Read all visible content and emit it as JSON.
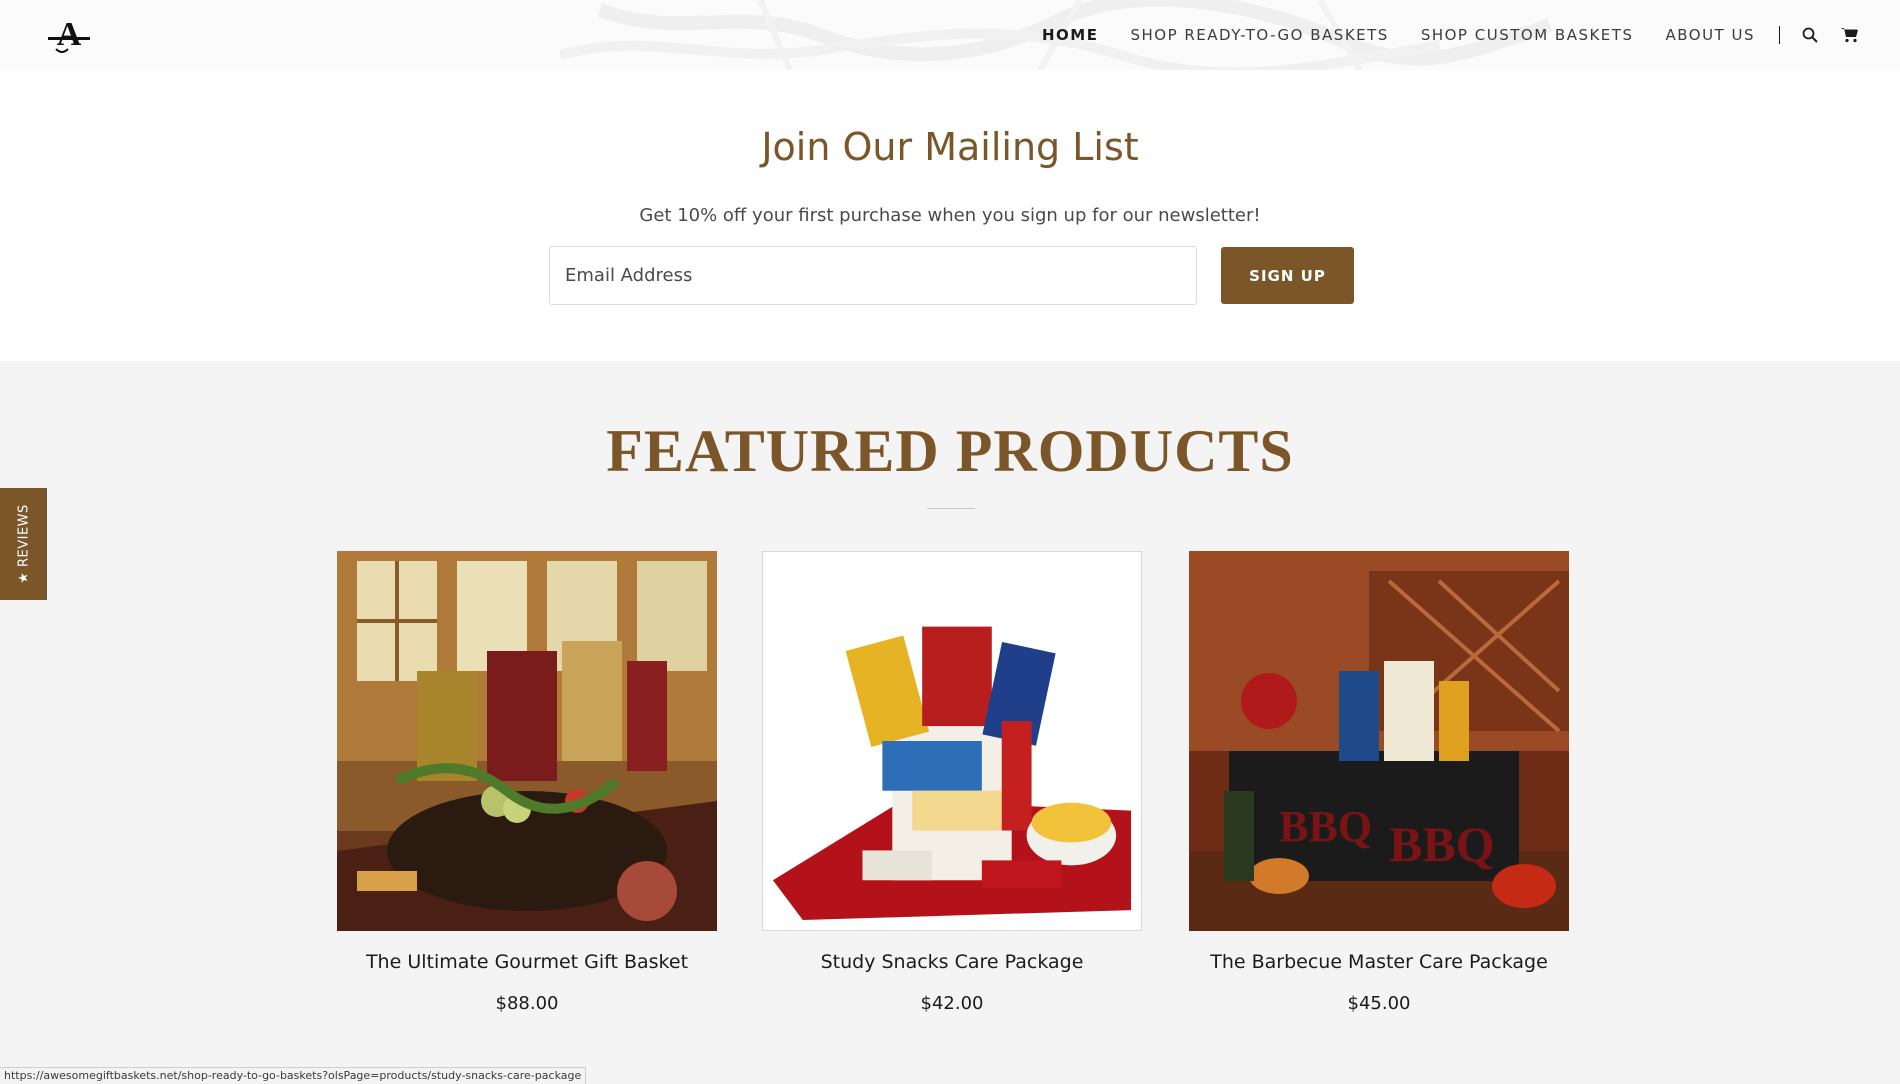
{
  "header": {
    "nav": [
      {
        "label": "HOME",
        "active": true
      },
      {
        "label": "SHOP READY-TO-GO BASKETS",
        "active": false
      },
      {
        "label": "SHOP CUSTOM BASKETS",
        "active": false
      },
      {
        "label": "ABOUT US",
        "active": false
      }
    ],
    "icons": {
      "search": "search-icon",
      "cart": "cart-icon"
    }
  },
  "mailing": {
    "title": "Join Our Mailing List",
    "subtitle": "Get 10% off your first purchase when you sign up for our newsletter!",
    "email_placeholder": "Email Address",
    "signup_label": "SIGN UP"
  },
  "featured": {
    "title": "FEATURED PRODUCTS",
    "products": [
      {
        "name": "The Ultimate Gourmet Gift Basket",
        "price": "$88.00"
      },
      {
        "name": "Study Snacks Care Package",
        "price": "$42.00"
      },
      {
        "name": "The Barbecue Master Care Package",
        "price": "$45.00"
      }
    ]
  },
  "reviews_tab": {
    "label": "★ REVIEWS"
  },
  "status_bar": {
    "url": "https://awesomegiftbaskets.net/shop-ready-to-go-baskets?olsPage=products/study-snacks-care-package"
  },
  "colors": {
    "accent": "#7b5629",
    "featured_bg": "#f4f4f4",
    "text": "#1b1b1b"
  }
}
